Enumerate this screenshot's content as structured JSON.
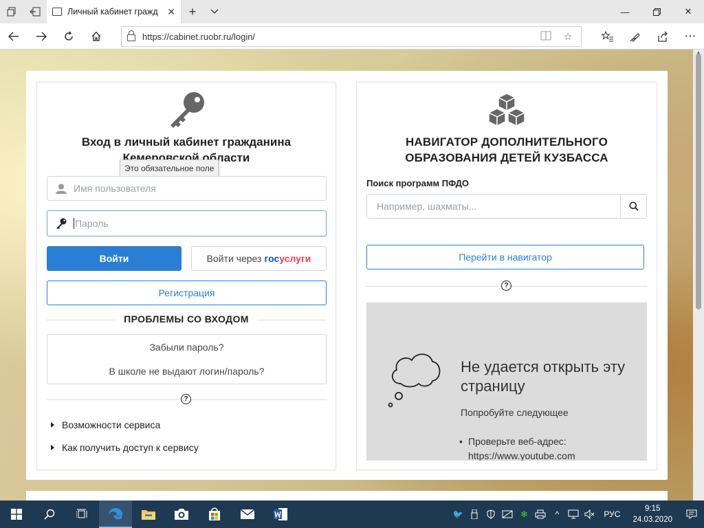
{
  "browser": {
    "tab_title": "Личный кабинет гражд",
    "url": "https://cabinet.ruobr.ru/login/"
  },
  "login": {
    "title_line1": "Вход в личный кабинет гражданина",
    "title_line2": "Кемеровской области",
    "tooltip": "Это обязательное поле",
    "username_placeholder": "Имя пользователя",
    "password_placeholder": "Пароль",
    "login_button": "Войти",
    "gosuslugi_prefix": "Войти через",
    "gosuslugi_gos": "гос",
    "gosuslugi_uslugi": "услуги",
    "register_button": "Регистрация",
    "problems_heading": "ПРОБЛЕМЫ СО ВХОДОМ",
    "forgot_password": "Забыли пароль?",
    "school_no_login": "В школе не выдают логин/пароль?",
    "help_glyph": "?",
    "info_items": [
      "Возможности сервиса",
      "Как получить доступ к сервису"
    ]
  },
  "navigator": {
    "title_line1": "НАВИГАТОР ДОПОЛНИТЕЛЬНОГО",
    "title_line2": "ОБРАЗОВАНИЯ ДЕТЕЙ КУЗБАССА",
    "search_label": "Поиск программ ПФДО",
    "search_placeholder": "Например, шахматы...",
    "go_button": "Перейти в навигатор",
    "help_glyph": "?",
    "error": {
      "title": "Не удается открыть эту страницу",
      "subtitle": "Попробуйте следующее",
      "bullet_line1": "Проверьте веб-адрес:",
      "bullet_line2": "https://www.youtube.com",
      "bullet_dot": "•"
    }
  },
  "taskbar": {
    "language": "РУС",
    "time": "9:15",
    "date": "24.03.2020"
  },
  "colors": {
    "primary": "#2a7fd4",
    "gos_blue": "#0d4cd3",
    "gos_red": "#ee3f58",
    "taskbar": "#1e3a52"
  }
}
